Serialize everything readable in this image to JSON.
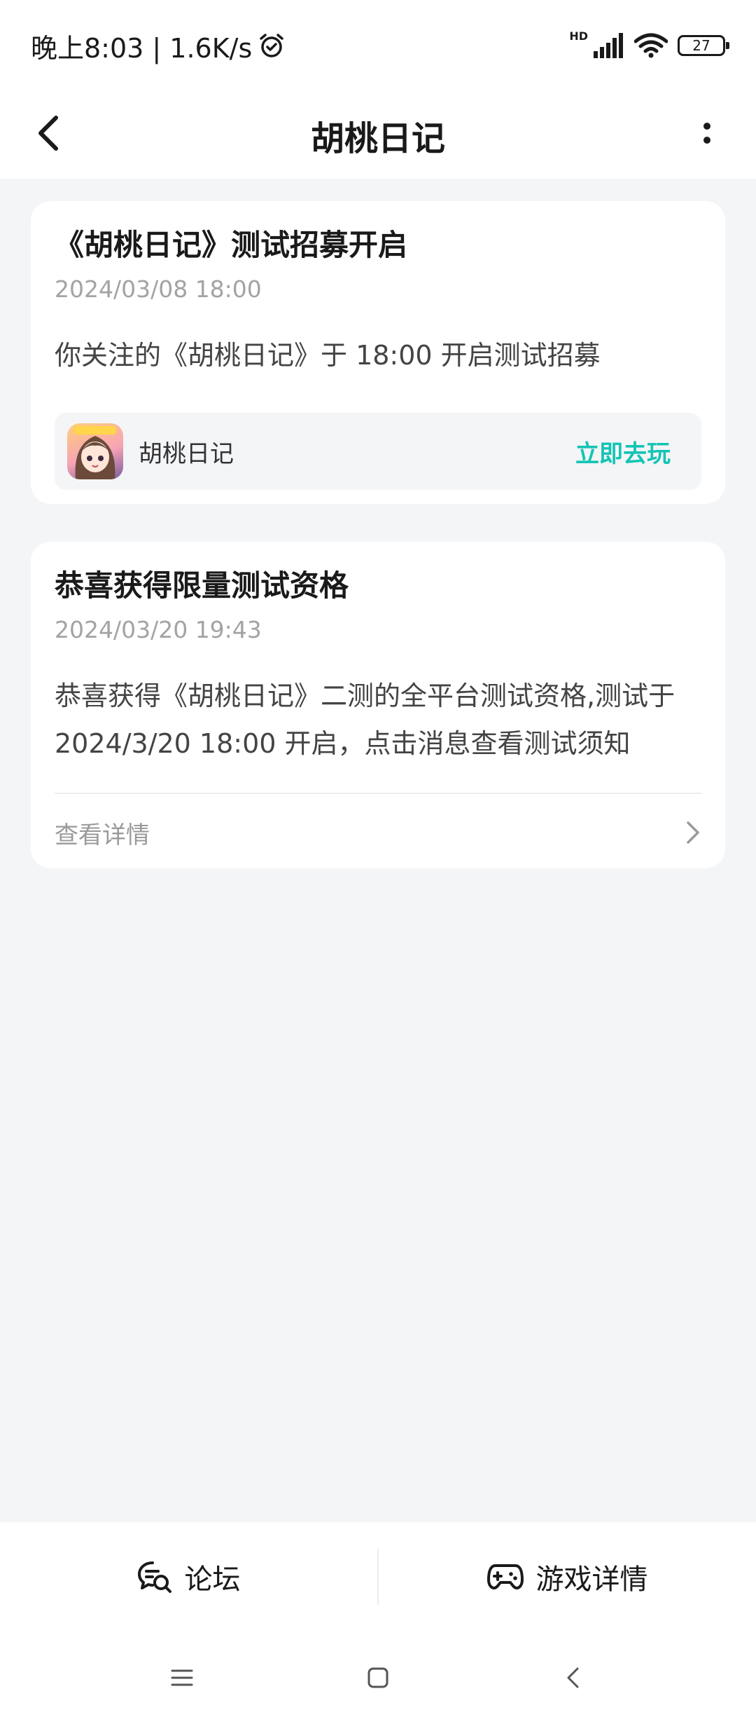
{
  "status_bar": {
    "time": "晚上8:03 | 1.6K/s",
    "hd_label": "HD",
    "battery_level": "27"
  },
  "nav": {
    "title": "胡桃日记"
  },
  "messages": [
    {
      "title": "《胡桃日记》测试招募开启",
      "time": "2024/03/08 18:00",
      "body": "你关注的《胡桃日记》于 18:00 开启测试招募",
      "game_name": "胡桃日记",
      "action_label": "立即去玩"
    },
    {
      "title": "恭喜获得限量测试资格",
      "time": "2024/03/20 19:43",
      "body": "恭喜获得《胡桃日记》二测的全平台测试资格,测试于2024/3/20 18:00 开启，点击消息查看测试须知",
      "detail_label": "查看详情"
    }
  ],
  "bottom_tabs": [
    {
      "label": "论坛",
      "icon": "forum-chat-icon"
    },
    {
      "label": "游戏详情",
      "icon": "gamepad-icon"
    }
  ],
  "colors": {
    "accent": "#14c4b5",
    "background": "#f4f5f7",
    "card": "#ffffff"
  }
}
